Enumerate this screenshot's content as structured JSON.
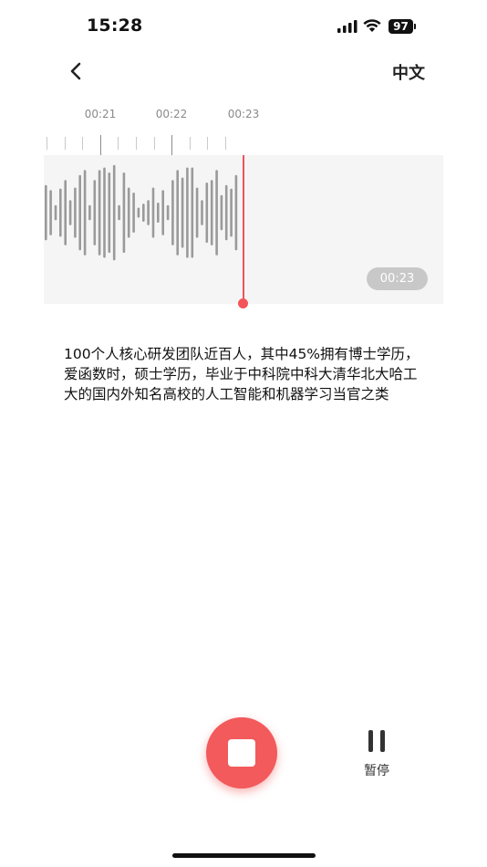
{
  "status_bar": {
    "time": "15:28",
    "battery": "97",
    "icons": [
      "cellular-signal-icon",
      "wifi-icon",
      "battery-icon"
    ]
  },
  "header": {
    "back_icon": "chevron-left-icon",
    "language": "中文"
  },
  "timeline": {
    "labels": [
      "00:21",
      "00:22",
      "00:23"
    ]
  },
  "waveform": {
    "current_time": "00:23",
    "amplitudes": [
      0.55,
      0.45,
      0.15,
      0.48,
      0.65,
      0.25,
      0.5,
      0.75,
      0.85,
      0.15,
      0.65,
      0.85,
      0.9,
      0.8,
      0.95,
      0.15,
      0.8,
      0.5,
      0.4,
      0.1,
      0.18,
      0.25,
      0.5,
      0.2,
      0.45,
      0.15,
      0.65,
      0.85,
      0.7,
      0.9,
      0.9,
      0.5,
      0.25,
      0.6,
      0.65,
      0.85,
      0.35,
      0.55,
      0.48,
      0.75
    ],
    "accent_color": "#f3545a"
  },
  "transcript": {
    "text": "100个人核心研发团队近百人，其中45%拥有博士学历，爱函数时，硕士学历，毕业于中科院中科大清华北大哈工大的国内外知名高校的人工智能和机器学习当官之类"
  },
  "controls": {
    "stop_icon": "stop-square-icon",
    "pause_icon": "pause-icon",
    "pause_label": "暂停",
    "stop_color": "#f25a5c"
  }
}
